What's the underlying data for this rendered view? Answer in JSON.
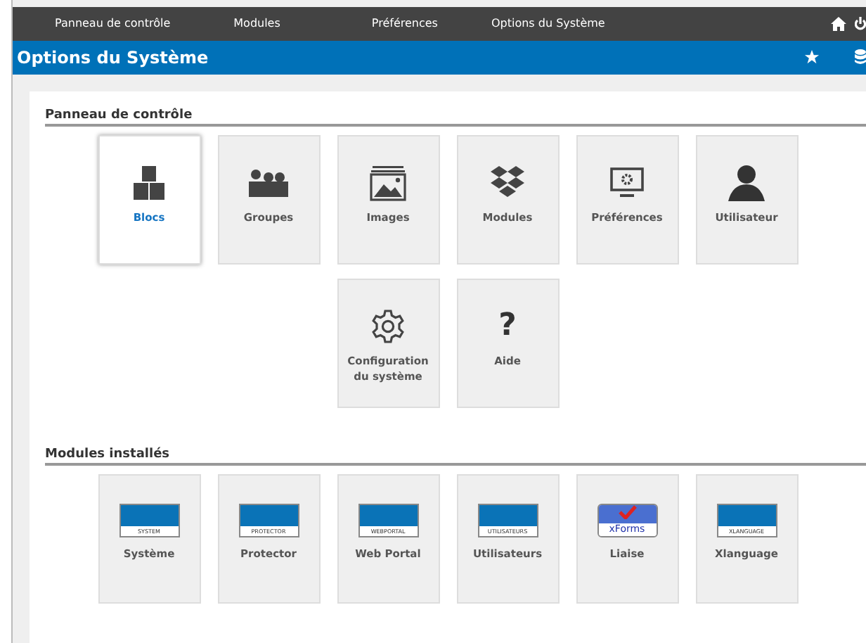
{
  "top_menu": [
    {
      "label": "Panneau de contrôle"
    },
    {
      "label": "Modules"
    },
    {
      "label": "Préférences"
    },
    {
      "label": "Options du Système"
    }
  ],
  "title": "Options du Système",
  "sections": [
    {
      "heading": "Panneau de contrôle",
      "tiles": [
        {
          "label": "Blocs",
          "kind": "blocks",
          "selected": true
        },
        {
          "label": "Groupes",
          "kind": "groups",
          "selected": false
        },
        {
          "label": "Images",
          "kind": "images",
          "selected": false
        },
        {
          "label": "Modules",
          "kind": "modules",
          "selected": false
        },
        {
          "label": "Préférences",
          "kind": "preferences",
          "selected": false
        },
        {
          "label": "Utilisateur",
          "kind": "user",
          "selected": false
        },
        {
          "label": "Configuration du système",
          "kind": "gear",
          "selected": false
        },
        {
          "label": "Aide",
          "kind": "help",
          "glyph": "?",
          "selected": false
        }
      ]
    },
    {
      "heading": "Modules installés",
      "tiles": [
        {
          "label": "Système",
          "kind": "logo",
          "logo_text": "SYSTEM",
          "selected": false
        },
        {
          "label": "Protector",
          "kind": "logo",
          "logo_text": "PROTECTOR",
          "selected": false
        },
        {
          "label": "Web Portal",
          "kind": "logo",
          "logo_text": "WEBPORTAL",
          "selected": false
        },
        {
          "label": "Utilisateurs",
          "kind": "logo",
          "logo_text": "UTILISATEURS",
          "selected": false
        },
        {
          "label": "Liaise",
          "kind": "xforms",
          "logo_text": "xForms",
          "selected": false
        },
        {
          "label": "Xlanguage",
          "kind": "logo",
          "logo_text": "XLANGUAGE",
          "selected": false
        }
      ]
    }
  ]
}
